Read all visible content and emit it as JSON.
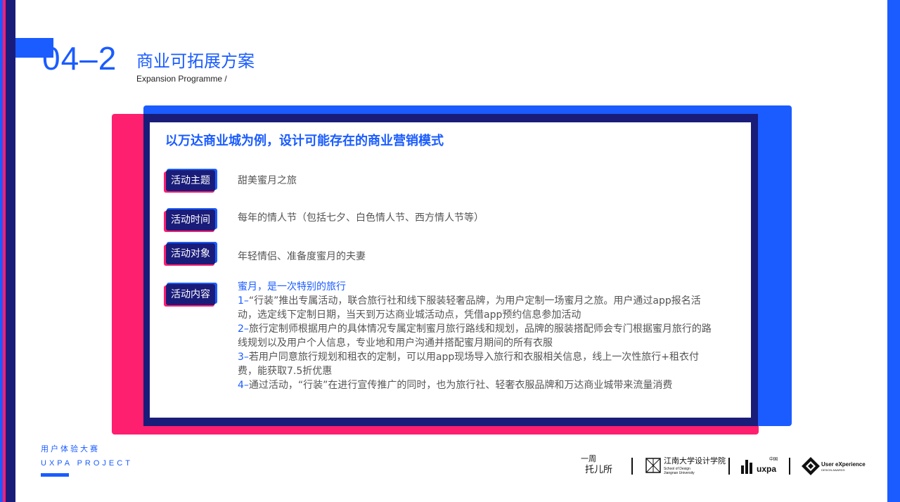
{
  "header": {
    "section_number": "04–2",
    "title_cn": "商业可拓展方案",
    "title_en": "Expansion Programme /"
  },
  "card": {
    "heading": "以万达商业城为例，设计可能存在的商业营销模式",
    "rows": [
      {
        "label": "活动主题",
        "value": "甜美蜜月之旅"
      },
      {
        "label": "活动时间",
        "value": "每年的情人节（包括七夕、白色情人节、西方情人节等）"
      },
      {
        "label": "活动对象",
        "value": "年轻情侣、准备度蜜月的夫妻"
      },
      {
        "label": "活动内容",
        "value": ""
      }
    ],
    "content": {
      "headline": "蜜月，是一次特别的旅行",
      "items": [
        {
          "num": "1–",
          "text": "“行装”推出专属活动，联合旅行社和线下服装轻奢品牌，为用户定制一场蜜月之旅。用户通过app报名活动，选定线下定制日期，当天到万达商业城活动点，凭借app预约信息参加活动"
        },
        {
          "num": "2–",
          "text": "旅行定制师根据用户的具体情况专属定制蜜月旅行路线和规划，品牌的服装搭配师会专门根据蜜月旅行的路线规划以及用户个人信息，专业地和用户沟通并搭配蜜月期间的所有衣服"
        },
        {
          "num": "3–",
          "text": "若用户同意旅行规划和租衣的定制，可以用app现场导入旅行和衣服相关信息，线上一次性旅行+租衣付费，能获取7.5折优惠"
        },
        {
          "num": "4–",
          "text": "通过活动，“行装”在进行宣传推广的同时，也为旅行社、轻奢衣服品牌和万达商业城带来流量消费"
        }
      ]
    }
  },
  "footer": {
    "label_cn": "用户体验大赛",
    "label_en": "UXPA PROJECT",
    "logos": [
      {
        "line1": "一周",
        "line2": "托儿所"
      },
      {
        "main": "江南大学设计学院",
        "sub1": "School of Design",
        "sub2": "Jiangnan University"
      },
      {
        "main": "uxpa",
        "small": "中国"
      },
      {
        "main": "User eXperience",
        "sub": "DESIGN AWARDS"
      }
    ]
  },
  "colors": {
    "primary_blue": "#1a5cff",
    "accent_pink": "#ff1f6f",
    "navy": "#1a1c7a",
    "text_gray": "#555555"
  }
}
